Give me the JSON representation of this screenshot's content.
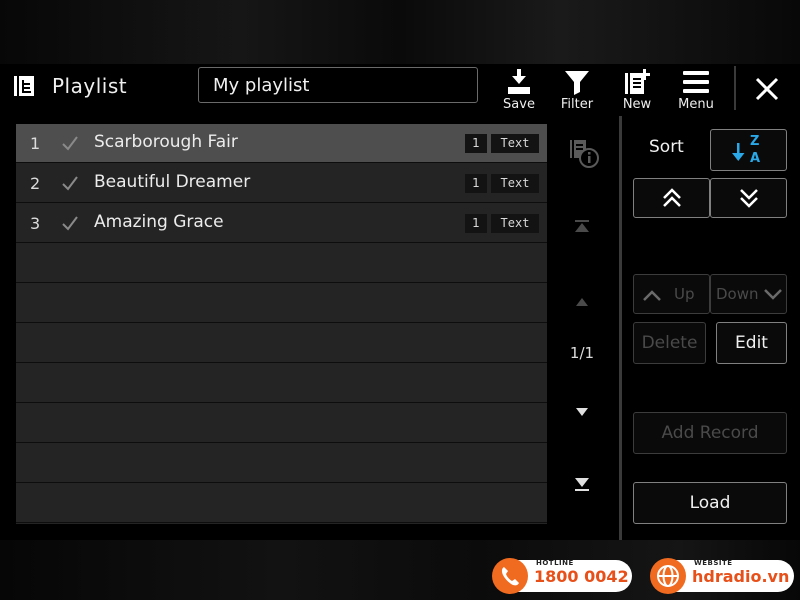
{
  "header": {
    "title": "Playlist",
    "playlist_name": "My playlist",
    "tools": [
      {
        "label": "Save",
        "icon": "save-icon"
      },
      {
        "label": "Filter",
        "icon": "filter-icon"
      },
      {
        "label": "New",
        "icon": "new-icon"
      },
      {
        "label": "Menu",
        "icon": "menu-icon"
      }
    ],
    "close_icon": "close-icon"
  },
  "list": {
    "rows": [
      {
        "num": "1",
        "name": "Scarborough Fair",
        "count": "1",
        "type": "Text",
        "checked": true,
        "selected": true
      },
      {
        "num": "2",
        "name": "Beautiful Dreamer",
        "count": "1",
        "type": "Text",
        "checked": true,
        "selected": false
      },
      {
        "num": "3",
        "name": "Amazing Grace",
        "count": "1",
        "type": "Text",
        "checked": true,
        "selected": false
      }
    ],
    "empty_row_count": 7
  },
  "scroll": {
    "page": "1/1",
    "info_icon": "playlist-info-icon"
  },
  "panel": {
    "sort_label": "Sort",
    "up_label": "Up",
    "down_label": "Down",
    "delete_label": "Delete",
    "edit_label": "Edit",
    "add_record_label": "Add Record",
    "load_label": "Load"
  },
  "watermark": {
    "hotline_caption": "HOTLINE",
    "hotline_number": "1800 0042",
    "website_caption": "WEBSITE",
    "website_url": "hdradio.vn"
  },
  "colors": {
    "accent_blue": "#2aa8e8",
    "brand_orange": "#f06a1f",
    "selected_row": "#4e4e4e"
  }
}
